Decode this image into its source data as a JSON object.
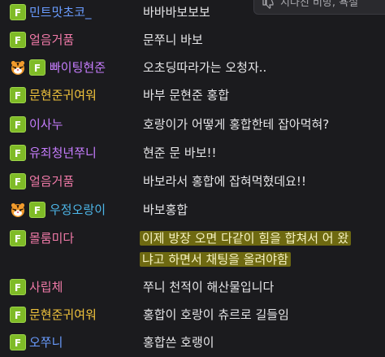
{
  "tooltip": {
    "text": "지나친 비방, 욕설",
    "icon": "thumbs-down-icon"
  },
  "colors": {
    "background": "#1b1b1e",
    "fan_badge": "#7fbb27",
    "highlight": "#e2d600"
  },
  "messages": [
    {
      "nick": "민트맛초코_",
      "nick_color": "#6a9cff",
      "badges": [
        "fan"
      ],
      "text": "바바바보보보"
    },
    {
      "nick": "얼음거품",
      "nick_color": "#f07aa8",
      "badges": [
        "fan"
      ],
      "text": "문쭈니 바보"
    },
    {
      "nick": "빠이팅현준",
      "nick_color": "#c77dff",
      "badges": [
        "tiger",
        "fan"
      ],
      "text": "오초딩따라가는 오청자.."
    },
    {
      "nick": "문현준귀여워",
      "nick_color": "#f0c33c",
      "badges": [
        "fan"
      ],
      "text": "바부 문현준 홍합"
    },
    {
      "nick": "이사누",
      "nick_color": "#c77dff",
      "badges": [
        "fan"
      ],
      "text": "호랑이가 어떻게 홍합한테 잡아먹혀?"
    },
    {
      "nick": "유죄청년쭈니",
      "nick_color": "#c77dff",
      "badges": [
        "fan"
      ],
      "text": "현준 문 바보!!"
    },
    {
      "nick": "얼음거품",
      "nick_color": "#f07aa8",
      "badges": [
        "fan"
      ],
      "text": "바보라서 홍합에 잡혀먹혔데요!!"
    },
    {
      "nick": "우정오랑이",
      "nick_color": "#4db6e8",
      "badges": [
        "tiger",
        "fan"
      ],
      "text": "바보홍합"
    },
    {
      "nick": "몰룸미다",
      "nick_color": "#f07aa8",
      "badges": [
        "fan"
      ],
      "text_lines": [
        "이제 방장 오면 다같이 힘을 합쳐서 어 왔",
        "냐고 하면서 채팅을 올려야함"
      ]
    },
    {
      "nick": "사립체",
      "nick_color": "#f07aa8",
      "badges": [
        "fan"
      ],
      "text": "쭈니 천적이 해산물입니다"
    },
    {
      "nick": "문현준귀여워",
      "nick_color": "#f0c33c",
      "badges": [
        "fan"
      ],
      "text": "홍합이 호랑이 츄르로 길들임"
    },
    {
      "nick": "오쭈니",
      "nick_color": "#6a9cff",
      "badges": [
        "fan"
      ],
      "text": "홍합쓴 호랭이"
    }
  ]
}
